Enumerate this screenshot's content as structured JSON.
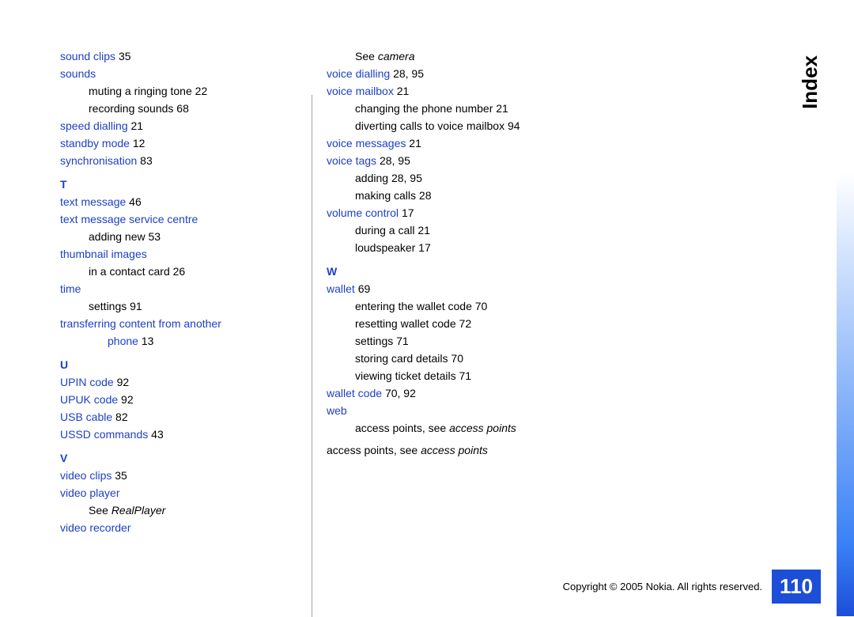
{
  "chapter_tab": "Index",
  "page_number": "110",
  "copyright": "Copyright © 2005 Nokia. All rights reserved.",
  "col1": {
    "e0": {
      "t": "sound clips",
      "p": "35"
    },
    "e1": {
      "t": "sounds"
    },
    "e1a": {
      "t": "muting a ringing tone",
      "p": "22"
    },
    "e1b": {
      "t": "recording sounds",
      "p": "68"
    },
    "e2": {
      "t": "speed dialling",
      "p": "21"
    },
    "e3": {
      "t": "standby mode",
      "p": "12"
    },
    "e4": {
      "t": "synchronisation",
      "p": "83"
    },
    "T": "T",
    "e5": {
      "t": "text message",
      "p": "46"
    },
    "e6": {
      "t": "text message service centre"
    },
    "e6a": {
      "t": "adding new",
      "p": "53"
    },
    "e7": {
      "t": "thumbnail images"
    },
    "e7a": {
      "t": "in a contact card",
      "p": "26"
    },
    "e8": {
      "t": "time"
    },
    "e8a": {
      "t": "settings",
      "p": "91"
    },
    "e9": {
      "t": "transferring content from another"
    },
    "e9b": {
      "t": "phone",
      "p": "13"
    },
    "U": "U",
    "e10": {
      "t": "UPIN code",
      "p": "92"
    },
    "e11": {
      "t": "UPUK code",
      "p": "92"
    },
    "e12": {
      "t": "USB cable",
      "p": "82"
    },
    "e13": {
      "t": "USSD commands",
      "p": "43"
    },
    "V": "V",
    "e14": {
      "t": "video clips",
      "p": "35"
    },
    "e15": {
      "t": "video player"
    },
    "e15a_pre": "See ",
    "e15a_it": "RealPlayer",
    "e16": {
      "t": "video recorder"
    }
  },
  "col2": {
    "e0_pre": "See ",
    "e0_it": "camera",
    "e1": {
      "t": "voice dialling",
      "p": "28, 95"
    },
    "e2": {
      "t": "voice mailbox",
      "p": "21"
    },
    "e2a": {
      "t": "changing the phone number",
      "p": "21"
    },
    "e2b": {
      "t": "diverting calls to voice mailbox",
      "p": "94"
    },
    "e3": {
      "t": "voice messages",
      "p": "21"
    },
    "e4": {
      "t": "voice tags",
      "p": "28, 95"
    },
    "e4a": {
      "t": "adding",
      "p": "28, 95"
    },
    "e4b": {
      "t": "making calls",
      "p": "28"
    },
    "e5": {
      "t": "volume control",
      "p": "17"
    },
    "e5a": {
      "t": "during a call",
      "p": "21"
    },
    "e5b": {
      "t": "loudspeaker",
      "p": "17"
    },
    "W": "W",
    "e6": {
      "t": "wallet",
      "p": "69"
    },
    "e6a": {
      "t": "entering the wallet code",
      "p": "70"
    },
    "e6b": {
      "t": "resetting wallet code",
      "p": "72"
    },
    "e6c": {
      "t": "settings",
      "p": "71"
    },
    "e6d": {
      "t": "storing card details",
      "p": "70"
    },
    "e6e": {
      "t": "viewing ticket details",
      "p": "71"
    },
    "e7": {
      "t": "wallet code",
      "p": "70, 92"
    },
    "e8": {
      "t": "web"
    },
    "e8a_pre": "access points, see ",
    "e8a_it": "access points",
    "e9_pre": "access points, see ",
    "e9_it": "access points"
  }
}
